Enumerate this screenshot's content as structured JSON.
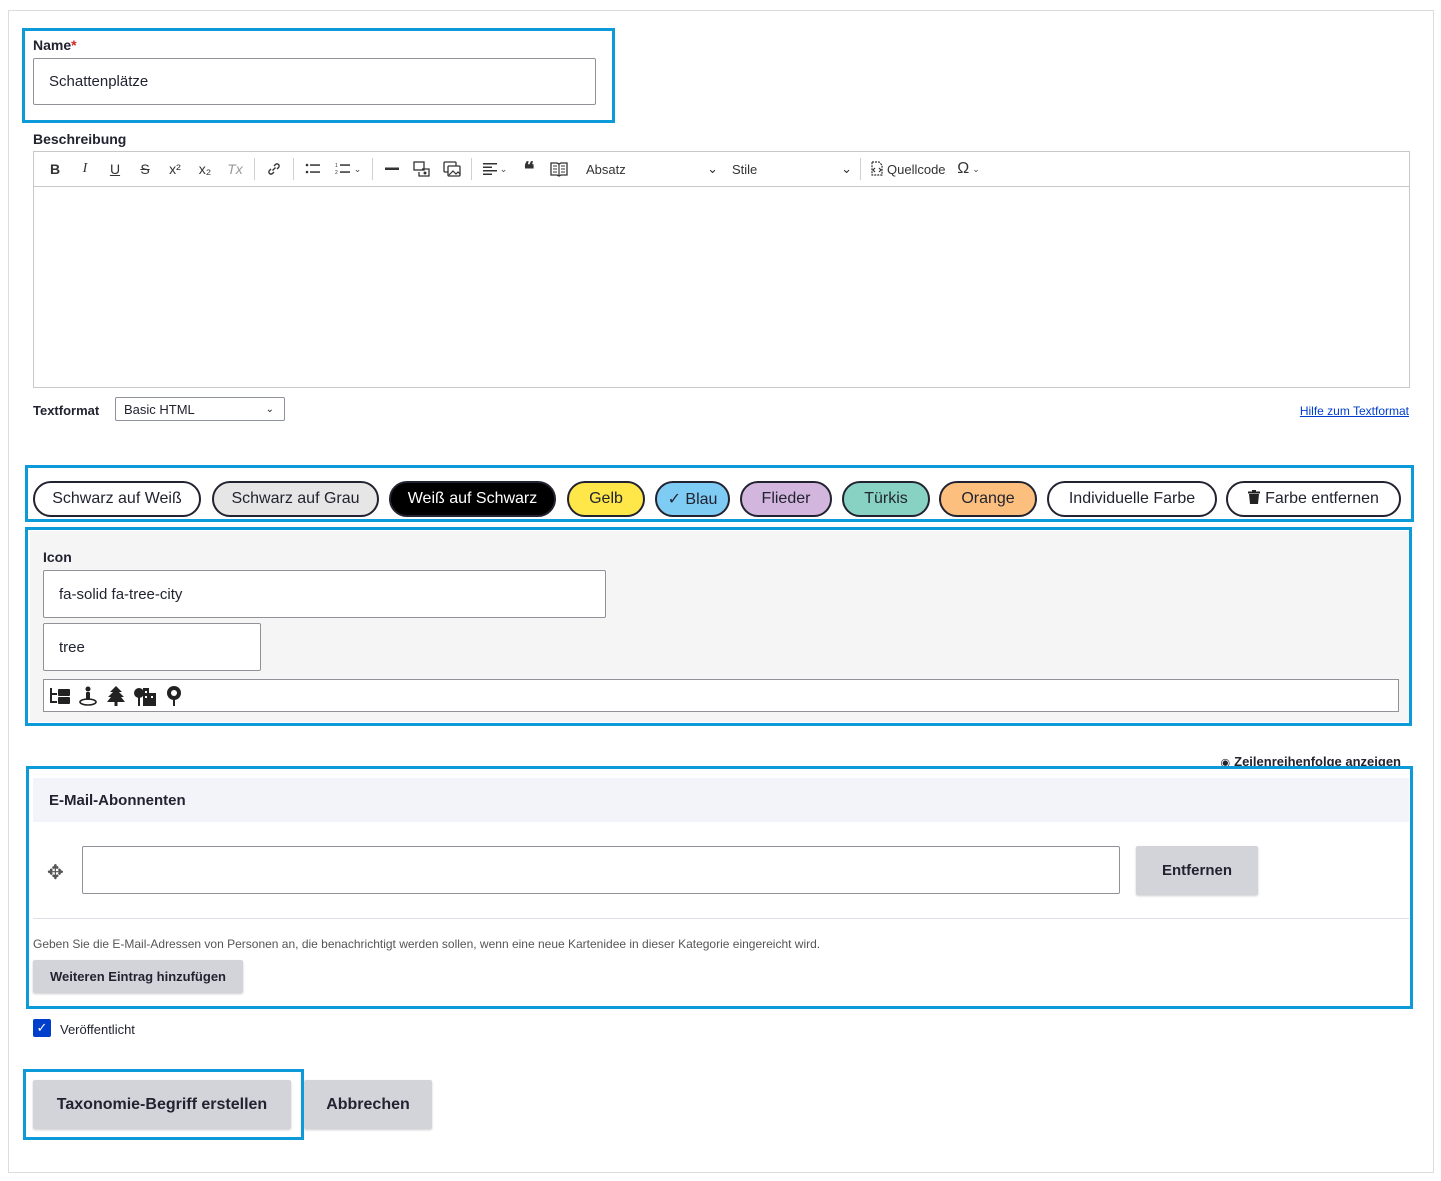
{
  "name_field": {
    "label": "Name",
    "required_mark": "*",
    "value": "Schattenplätze"
  },
  "description": {
    "label": "Beschreibung",
    "toolbar": {
      "bold": "B",
      "italic": "I",
      "underline": "U",
      "strike": "S",
      "superscript": "x²",
      "subscript": "x₂",
      "remove_format": "Tx",
      "paragraph_dropdown": "Absatz",
      "style_dropdown": "Stile",
      "source_button": "Quellcode",
      "special_chars": "Ω"
    }
  },
  "text_format": {
    "label": "Textformat",
    "selected": "Basic HTML",
    "help_link": "Hilfe zum Textformat"
  },
  "color_options": [
    {
      "label": "Schwarz auf Weiß",
      "bg": "#ffffff",
      "fg": "#222330"
    },
    {
      "label": "Schwarz auf Grau",
      "bg": "#e6e6e6",
      "fg": "#222330"
    },
    {
      "label": "Weiß auf Schwarz",
      "bg": "#000000",
      "fg": "#ffffff"
    },
    {
      "label": "Gelb",
      "bg": "#ffe74a",
      "fg": "#222330"
    },
    {
      "label": "✓ Blau",
      "bg": "#7ecbf3",
      "fg": "#222330"
    },
    {
      "label": "Flieder",
      "bg": "#d2b6de",
      "fg": "#222330"
    },
    {
      "label": "Türkis",
      "bg": "#88d2c3",
      "fg": "#222330"
    },
    {
      "label": "Orange",
      "bg": "#fcbf7d",
      "fg": "#222330"
    },
    {
      "label": "Individuelle Farbe",
      "bg": "#ffffff",
      "fg": "#222330"
    },
    {
      "label": "Farbe entfernen",
      "bg": "#ffffff",
      "fg": "#222330"
    }
  ],
  "icon_field": {
    "label": "Icon",
    "value": "fa-solid fa-tree-city",
    "search_value": "tree",
    "results": [
      "folder-tree-icon",
      "person-pin-icon",
      "tree-icon",
      "tree-city-icon",
      "location-pin-icon"
    ]
  },
  "show_order_link": "Zeilenreihenfolge anzeigen",
  "email_subscribers": {
    "title": "E-Mail-Abonnenten",
    "email_value": "",
    "remove_button": "Entfernen",
    "description": "Geben Sie die E-Mail-Adressen von Personen an, die benachrichtigt werden sollen, wenn eine neue Kartenidee in dieser Kategorie eingereicht wird.",
    "add_more_button": "Weiteren Eintrag hinzufügen"
  },
  "published": {
    "label": "Veröffentlicht",
    "checked": true
  },
  "actions": {
    "submit": "Taxonomie-Begriff erstellen",
    "cancel": "Abbrechen"
  },
  "colors": {
    "highlight": "#0c9ad9",
    "primary_blue": "#003ecc"
  }
}
